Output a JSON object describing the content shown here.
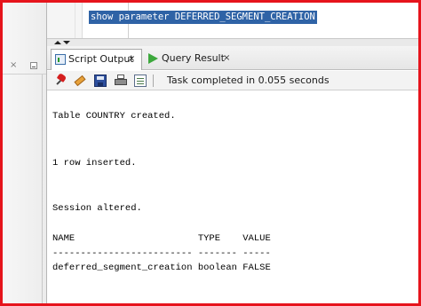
{
  "editor": {
    "code_line": "show parameter DEFERRED_SEGMENT_CREATION"
  },
  "left_panel": {
    "close_glyph": "×"
  },
  "tabs": [
    {
      "label": "Script Output",
      "close": "×",
      "icon": "script-output-icon",
      "active": true
    },
    {
      "label": "Query Result",
      "close": "×",
      "icon": "play-icon",
      "active": false
    }
  ],
  "toolbar": {
    "icons": [
      "pin-icon",
      "eraser-icon",
      "save-icon",
      "print-icon",
      "document-icon"
    ],
    "separator": "|",
    "status": "Task completed in 0.055 seconds"
  },
  "output": {
    "line_1": "Table COUNTRY created.",
    "line_2": "1 row inserted.",
    "line_3": "Session altered.",
    "header": "NAME                      TYPE    VALUE",
    "underline": "------------------------- ------- -----",
    "row_1": "deferred_segment_creation boolean FALSE"
  },
  "colors": {
    "frame_border": "#e6141c",
    "selection_bg": "#2f63a6"
  }
}
